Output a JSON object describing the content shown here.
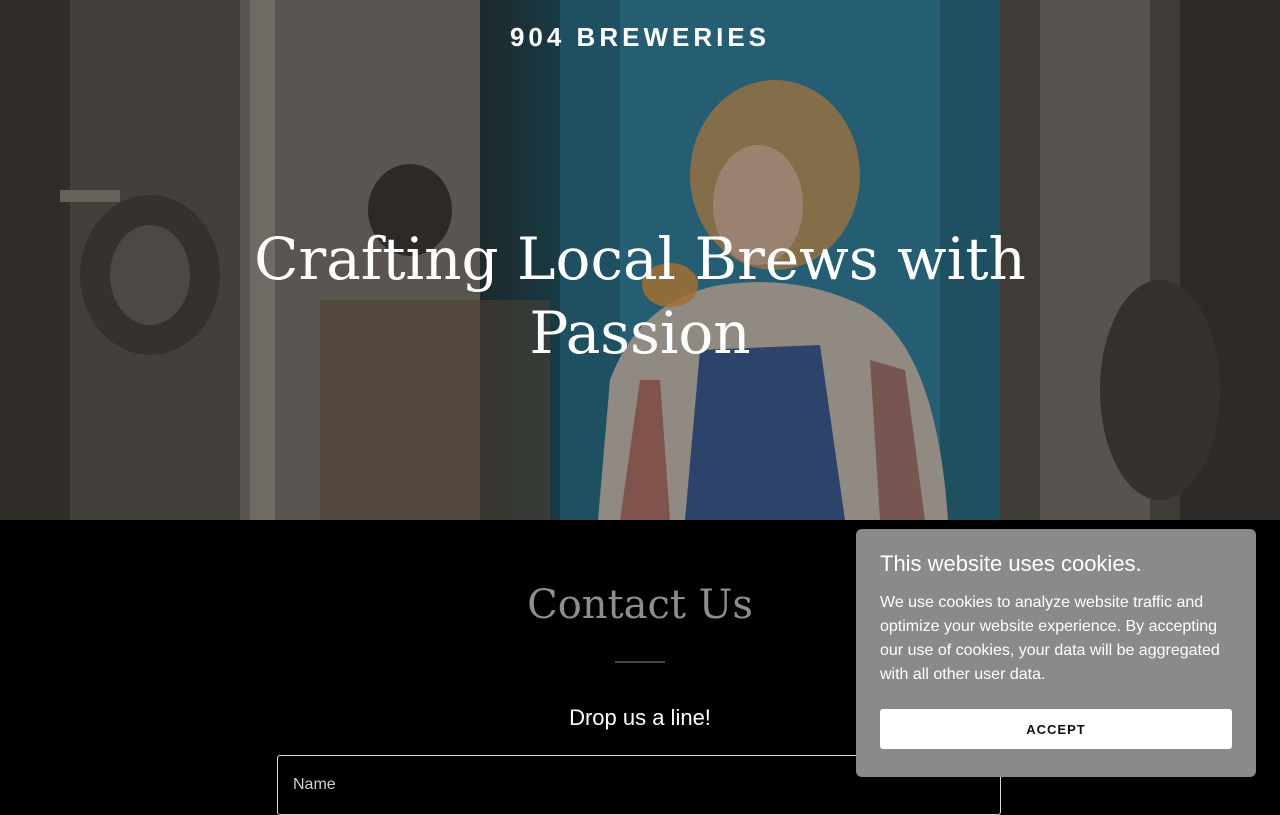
{
  "site": {
    "brand": "904 BREWERIES"
  },
  "hero": {
    "title": "Crafting Local Brews with Passion"
  },
  "contact": {
    "title": "Contact Us",
    "subtitle": "Drop us a line!",
    "name_placeholder": "Name"
  },
  "cookie_banner": {
    "title": "This website uses cookies.",
    "text": "We use cookies to analyze website traffic and optimize your website experience. By accepting our use of cookies, your data will be aggregated with all other user data.",
    "accept_label": "ACCEPT"
  },
  "colors": {
    "page_background": "#000000",
    "cookie_background": "#8a8a8a",
    "contact_title": "#8e8e8e"
  }
}
